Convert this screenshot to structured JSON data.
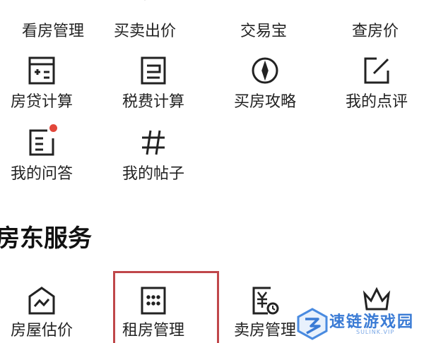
{
  "colors": {
    "icon_stroke": "#222222",
    "badge": "#e2473b",
    "highlight": "#c0474a",
    "watermark": "#3a7bd5"
  },
  "rows": [
    {
      "items": [
        {
          "label": "看房管理",
          "icon": "checklist-icon"
        },
        {
          "label": "买卖出价",
          "icon": "price-tag-icon"
        },
        {
          "label": "交易宝",
          "icon": "shield-icon"
        },
        {
          "label": "查房价",
          "icon": "clock-icon"
        }
      ]
    },
    {
      "items": [
        {
          "label": "房贷计算",
          "icon": "calculator-icon"
        },
        {
          "label": "税费计算",
          "icon": "tax-document-icon"
        },
        {
          "label": "买房攻略",
          "icon": "compass-icon"
        },
        {
          "label": "我的点评",
          "icon": "edit-icon"
        }
      ]
    },
    {
      "items": [
        {
          "label": "我的问答",
          "icon": "qa-document-icon",
          "badge": true
        },
        {
          "label": "我的帖子",
          "icon": "hashtag-icon"
        }
      ]
    }
  ],
  "landlord_section": {
    "title": "房东服务",
    "items": [
      {
        "label": "房屋估价",
        "icon": "house-valuation-icon"
      },
      {
        "label": "租房管理",
        "icon": "rental-building-icon",
        "highlighted": true
      },
      {
        "label": "卖房管理",
        "icon": "yen-document-icon"
      },
      {
        "label": "",
        "icon": "crown-icon"
      }
    ]
  },
  "watermark": {
    "text": "速链游戏园",
    "sub": "SULINK.VIP"
  }
}
